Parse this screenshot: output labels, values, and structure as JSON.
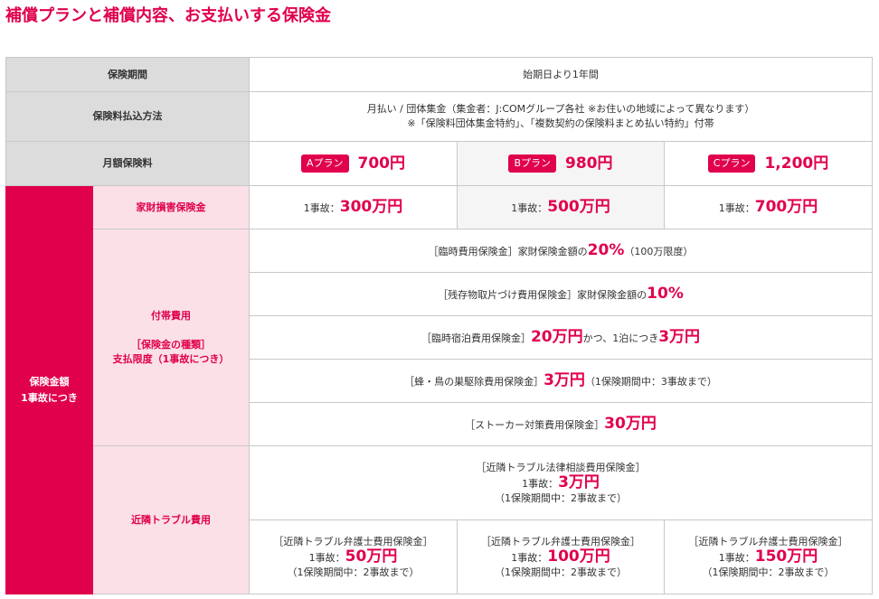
{
  "page_title": "補償プランと補償内容、お支払いする保険金",
  "rows": {
    "period": {
      "label": "保険期間",
      "value": "始期日より1年間"
    },
    "payment": {
      "label": "保険料払込方法",
      "line1": "月払い / 団体集金（集金者：J:COMグループ各社 ※お住いの地域によって異なります）",
      "line2": "※「保険料団体集金特約」、「複数契約の保険料まとめ払い特約」付帯"
    },
    "monthly": {
      "label": "月額保険料",
      "plans": [
        {
          "badge": "Aプラン",
          "price": "700円"
        },
        {
          "badge": "Bプラン",
          "price": "980円"
        },
        {
          "badge": "Cプラン",
          "price": "1,200円"
        }
      ]
    }
  },
  "side": {
    "line1": "保険金額",
    "line2": "1事故につき"
  },
  "property": {
    "label": "家財損害保険金",
    "prefix": "1事故：",
    "amounts": [
      "300万円",
      "500万円",
      "700万円"
    ]
  },
  "incidental": {
    "label1": "付帯費用",
    "label2": "［保険金の種類］",
    "label3": "支払限度（1事故につき）",
    "items": [
      {
        "a": "［臨時費用保険金］家財保険金額の",
        "b": "20%",
        "c": "（100万限度）"
      },
      {
        "a": "［残存物取片づけ費用保険金］家財保険金額の",
        "b": "10%",
        "c": ""
      },
      {
        "a": "［臨時宿泊費用保険金］",
        "b": "20万円",
        "c": "かつ、1泊につき",
        "d": "3万円"
      },
      {
        "a": "［蜂・鳥の巣駆除費用保険金］",
        "b": "3万円",
        "c": "（1保険期間中：3事故まで）"
      },
      {
        "a": "［ストーカー対策費用保険金］",
        "b": "30万円",
        "c": ""
      }
    ]
  },
  "neighbor": {
    "label": "近隣トラブル費用",
    "legal": {
      "name": "［近隣トラブル法律相談費用保険金］",
      "prefix": "1事故：",
      "amount": "3万円",
      "note": "（1保険期間中：2事故まで）"
    },
    "lawyer": {
      "name": "［近隣トラブル弁護士費用保険金］",
      "prefix": "1事故：",
      "amounts": [
        "50万円",
        "100万円",
        "150万円"
      ],
      "note": "（1保険期間中：2事故まで）"
    }
  },
  "colors": {
    "accent": "#e0004c",
    "header_gray": "#dcdcdc",
    "pink": "#fbe0e7"
  }
}
